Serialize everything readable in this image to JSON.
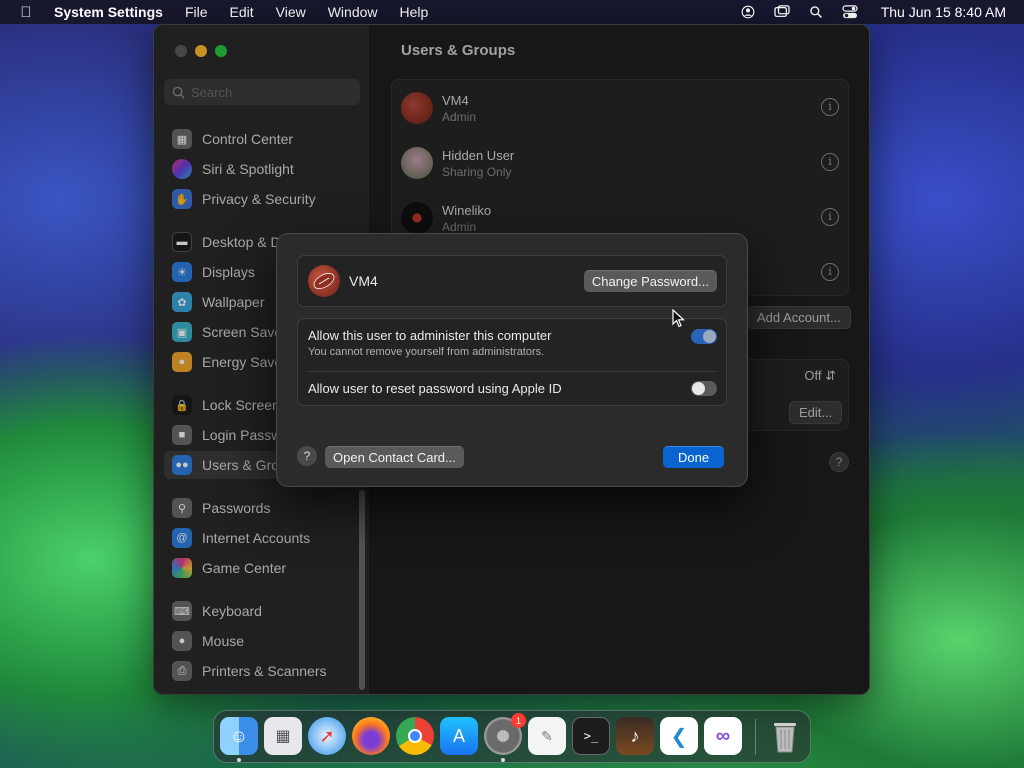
{
  "menubar": {
    "app_name": "System Settings",
    "menus": [
      "File",
      "Edit",
      "View",
      "Window",
      "Help"
    ],
    "clock": "Thu Jun 15  8:40 AM"
  },
  "sidebar": {
    "search_placeholder": "Search",
    "items": [
      {
        "label": "Control Center",
        "icon": "control-center-icon",
        "color": "#6b6b6b"
      },
      {
        "label": "Siri & Spotlight",
        "icon": "siri-icon",
        "color": "#c0398f"
      },
      {
        "label": "Privacy & Security",
        "icon": "hand-icon",
        "color": "#3d74d8"
      },
      {
        "label": "Desktop & Dock",
        "icon": "desktop-icon",
        "color": "#1c1c1c"
      },
      {
        "label": "Displays",
        "icon": "displays-icon",
        "color": "#2f7fe0"
      },
      {
        "label": "Wallpaper",
        "icon": "wallpaper-icon",
        "color": "#39a7d8"
      },
      {
        "label": "Screen Saver",
        "icon": "screen-saver-icon",
        "color": "#3bb3c9"
      },
      {
        "label": "Energy Saver",
        "icon": "energy-icon",
        "color": "#f2a72b"
      },
      {
        "label": "Lock Screen",
        "icon": "lock-icon",
        "color": "#1c1c1c"
      },
      {
        "label": "Login Password",
        "icon": "login-password-icon",
        "color": "#6b6b6b"
      },
      {
        "label": "Users & Groups",
        "icon": "users-icon",
        "color": "#2f7fe0"
      },
      {
        "label": "Passwords",
        "icon": "key-icon",
        "color": "#6b6b6b"
      },
      {
        "label": "Internet Accounts",
        "icon": "at-icon",
        "color": "#2f7fe0"
      },
      {
        "label": "Game Center",
        "icon": "game-center-icon",
        "color": "#e0e0e0"
      },
      {
        "label": "Keyboard",
        "icon": "keyboard-icon",
        "color": "#6b6b6b"
      },
      {
        "label": "Mouse",
        "icon": "mouse-icon",
        "color": "#6b6b6b"
      },
      {
        "label": "Printers & Scanners",
        "icon": "printer-icon",
        "color": "#6b6b6b"
      }
    ]
  },
  "content": {
    "title": "Users & Groups",
    "users": [
      {
        "name": "VM4",
        "role": "Admin"
      },
      {
        "name": "Hidden User",
        "role": "Sharing Only"
      },
      {
        "name": "Wineliko",
        "role": "Admin"
      }
    ],
    "add_account_label": "Add Account...",
    "auto_login_value": "Off",
    "edit_label": "Edit...",
    "help": "?"
  },
  "sheet": {
    "user_name": "VM4",
    "change_password_label": "Change Password...",
    "admin_title": "Allow this user to administer this computer",
    "admin_subtitle": "You cannot remove yourself from administrators.",
    "admin_toggle": true,
    "reset_title": "Allow user to reset password using Apple ID",
    "reset_toggle": false,
    "help": "?",
    "contact_card_label": "Open Contact Card...",
    "done_label": "Done"
  },
  "dock": {
    "apps": [
      {
        "name": "Finder",
        "running": true
      },
      {
        "name": "Launchpad",
        "running": false
      },
      {
        "name": "Safari",
        "running": false
      },
      {
        "name": "Firefox",
        "running": false
      },
      {
        "name": "Chrome",
        "running": false
      },
      {
        "name": "App Store",
        "running": false
      },
      {
        "name": "System Settings",
        "running": true,
        "badge": "1"
      },
      {
        "name": "TextEdit",
        "running": false
      },
      {
        "name": "Terminal",
        "running": false
      },
      {
        "name": "GarageBand",
        "running": false
      },
      {
        "name": "VS Code",
        "running": false
      },
      {
        "name": "Visual Studio",
        "running": false
      },
      {
        "name": "Trash",
        "running": false
      }
    ]
  }
}
